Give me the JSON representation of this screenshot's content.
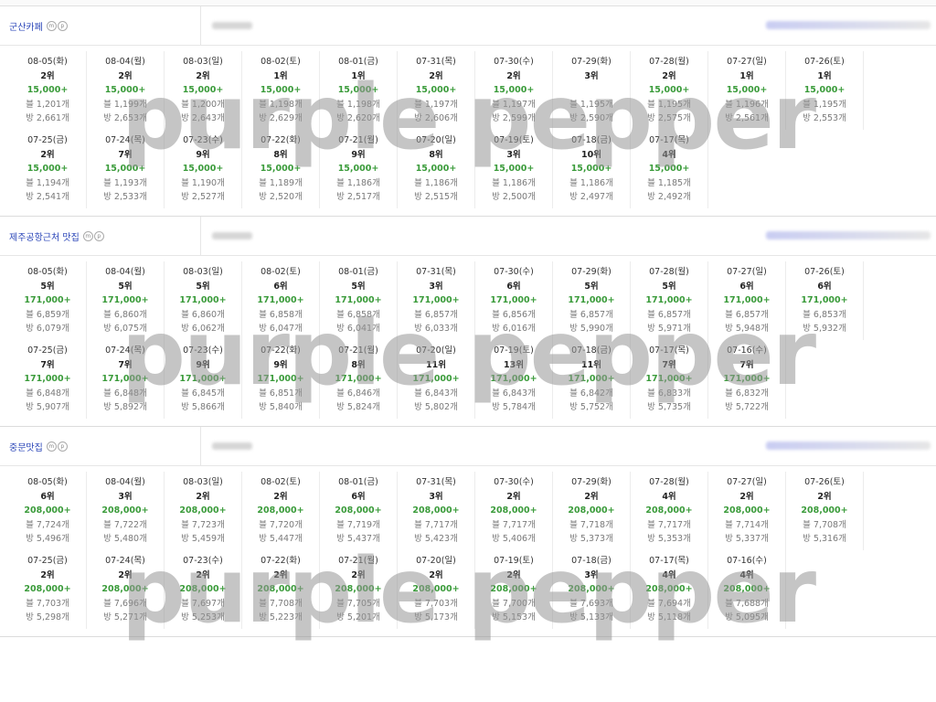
{
  "watermark": "purple pepper",
  "sections": [
    {
      "keyword": "군산카페",
      "icon_labels": [
        "m",
        "p"
      ],
      "rows": [
        [
          {
            "date": "08-05(화)",
            "rank": "2위",
            "vol": "15,000+",
            "blog": "블 1,201개",
            "cafe": "방 2,661개"
          },
          {
            "date": "08-04(월)",
            "rank": "2위",
            "vol": "15,000+",
            "blog": "블 1,199개",
            "cafe": "방 2,653개"
          },
          {
            "date": "08-03(일)",
            "rank": "2위",
            "vol": "15,000+",
            "blog": "블 1,200개",
            "cafe": "방 2,643개"
          },
          {
            "date": "08-02(토)",
            "rank": "1위",
            "vol": "15,000+",
            "blog": "블 1,198개",
            "cafe": "방 2,629개"
          },
          {
            "date": "08-01(금)",
            "rank": "1위",
            "vol": "15,000+",
            "blog": "블 1,198개",
            "cafe": "방 2,620개"
          },
          {
            "date": "07-31(목)",
            "rank": "2위",
            "vol": "15,000+",
            "blog": "블 1,197개",
            "cafe": "방 2,606개"
          },
          {
            "date": "07-30(수)",
            "rank": "2위",
            "vol": "15,000+",
            "blog": "블 1,197개",
            "cafe": "방 2,599개"
          },
          {
            "date": "07-29(화)",
            "rank": "3위",
            "vol": "",
            "blog": "블 1,195개",
            "cafe": "방 2,590개"
          },
          {
            "date": "07-28(월)",
            "rank": "2위",
            "vol": "15,000+",
            "blog": "블 1,195개",
            "cafe": "방 2,575개"
          },
          {
            "date": "07-27(일)",
            "rank": "1위",
            "vol": "15,000+",
            "blog": "블 1,196개",
            "cafe": "방 2,561개"
          },
          {
            "date": "07-26(토)",
            "rank": "1위",
            "vol": "15,000+",
            "blog": "블 1,195개",
            "cafe": "방 2,553개"
          }
        ],
        [
          {
            "date": "07-25(금)",
            "rank": "2위",
            "vol": "15,000+",
            "blog": "블 1,194개",
            "cafe": "방 2,541개"
          },
          {
            "date": "07-24(목)",
            "rank": "7위",
            "vol": "15,000+",
            "blog": "블 1,193개",
            "cafe": "방 2,533개"
          },
          {
            "date": "07-23(수)",
            "rank": "9위",
            "vol": "15,000+",
            "blog": "블 1,190개",
            "cafe": "방 2,527개"
          },
          {
            "date": "07-22(화)",
            "rank": "8위",
            "vol": "15,000+",
            "blog": "블 1,189개",
            "cafe": "방 2,520개"
          },
          {
            "date": "07-21(월)",
            "rank": "9위",
            "vol": "15,000+",
            "blog": "블 1,186개",
            "cafe": "방 2,517개"
          },
          {
            "date": "07-20(일)",
            "rank": "8위",
            "vol": "15,000+",
            "blog": "블 1,186개",
            "cafe": "방 2,515개"
          },
          {
            "date": "07-19(토)",
            "rank": "3위",
            "vol": "15,000+",
            "blog": "블 1,186개",
            "cafe": "방 2,500개"
          },
          {
            "date": "07-18(금)",
            "rank": "10위",
            "vol": "15,000+",
            "blog": "블 1,186개",
            "cafe": "방 2,497개"
          },
          {
            "date": "07-17(목)",
            "rank": "4위",
            "vol": "15,000+",
            "blog": "블 1,185개",
            "cafe": "방 2,492개"
          }
        ]
      ]
    },
    {
      "keyword": "제주공항근처 맛집",
      "icon_labels": [
        "m",
        "p"
      ],
      "rows": [
        [
          {
            "date": "08-05(화)",
            "rank": "5위",
            "vol": "171,000+",
            "blog": "블 6,859개",
            "cafe": "방 6,079개"
          },
          {
            "date": "08-04(월)",
            "rank": "5위",
            "vol": "171,000+",
            "blog": "블 6,860개",
            "cafe": "방 6,075개"
          },
          {
            "date": "08-03(일)",
            "rank": "5위",
            "vol": "171,000+",
            "blog": "블 6,860개",
            "cafe": "방 6,062개"
          },
          {
            "date": "08-02(토)",
            "rank": "6위",
            "vol": "171,000+",
            "blog": "블 6,858개",
            "cafe": "방 6,047개"
          },
          {
            "date": "08-01(금)",
            "rank": "5위",
            "vol": "171,000+",
            "blog": "블 6,858개",
            "cafe": "방 6,041개"
          },
          {
            "date": "07-31(목)",
            "rank": "3위",
            "vol": "171,000+",
            "blog": "블 6,857개",
            "cafe": "방 6,033개"
          },
          {
            "date": "07-30(수)",
            "rank": "6위",
            "vol": "171,000+",
            "blog": "블 6,856개",
            "cafe": "방 6,016개"
          },
          {
            "date": "07-29(화)",
            "rank": "5위",
            "vol": "171,000+",
            "blog": "블 6,857개",
            "cafe": "방 5,990개"
          },
          {
            "date": "07-28(월)",
            "rank": "5위",
            "vol": "171,000+",
            "blog": "블 6,857개",
            "cafe": "방 5,971개"
          },
          {
            "date": "07-27(일)",
            "rank": "6위",
            "vol": "171,000+",
            "blog": "블 6,857개",
            "cafe": "방 5,948개"
          },
          {
            "date": "07-26(토)",
            "rank": "6위",
            "vol": "171,000+",
            "blog": "블 6,853개",
            "cafe": "방 5,932개"
          }
        ],
        [
          {
            "date": "07-25(금)",
            "rank": "7위",
            "vol": "171,000+",
            "blog": "블 6,848개",
            "cafe": "방 5,907개"
          },
          {
            "date": "07-24(목)",
            "rank": "7위",
            "vol": "171,000+",
            "blog": "블 6,848개",
            "cafe": "방 5,892개"
          },
          {
            "date": "07-23(수)",
            "rank": "9위",
            "vol": "171,000+",
            "blog": "블 6,845개",
            "cafe": "방 5,866개"
          },
          {
            "date": "07-22(화)",
            "rank": "9위",
            "vol": "171,000+",
            "blog": "블 6,851개",
            "cafe": "방 5,840개"
          },
          {
            "date": "07-21(월)",
            "rank": "8위",
            "vol": "171,000+",
            "blog": "블 6,846개",
            "cafe": "방 5,824개"
          },
          {
            "date": "07-20(일)",
            "rank": "11위",
            "vol": "171,000+",
            "blog": "블 6,843개",
            "cafe": "방 5,802개"
          },
          {
            "date": "07-19(토)",
            "rank": "13위",
            "vol": "171,000+",
            "blog": "블 6,843개",
            "cafe": "방 5,784개"
          },
          {
            "date": "07-18(금)",
            "rank": "11위",
            "vol": "171,000+",
            "blog": "블 6,842개",
            "cafe": "방 5,752개"
          },
          {
            "date": "07-17(목)",
            "rank": "7위",
            "vol": "171,000+",
            "blog": "블 6,833개",
            "cafe": "방 5,735개"
          },
          {
            "date": "07-16(수)",
            "rank": "7위",
            "vol": "171,000+",
            "blog": "블 6,832개",
            "cafe": "방 5,722개"
          }
        ]
      ]
    },
    {
      "keyword": "중문맛집",
      "icon_labels": [
        "m",
        "p"
      ],
      "rows": [
        [
          {
            "date": "08-05(화)",
            "rank": "6위",
            "vol": "208,000+",
            "blog": "블 7,724개",
            "cafe": "방 5,496개"
          },
          {
            "date": "08-04(월)",
            "rank": "3위",
            "vol": "208,000+",
            "blog": "블 7,722개",
            "cafe": "방 5,480개"
          },
          {
            "date": "08-03(일)",
            "rank": "2위",
            "vol": "208,000+",
            "blog": "블 7,723개",
            "cafe": "방 5,459개"
          },
          {
            "date": "08-02(토)",
            "rank": "2위",
            "vol": "208,000+",
            "blog": "블 7,720개",
            "cafe": "방 5,447개"
          },
          {
            "date": "08-01(금)",
            "rank": "6위",
            "vol": "208,000+",
            "blog": "블 7,719개",
            "cafe": "방 5,437개"
          },
          {
            "date": "07-31(목)",
            "rank": "3위",
            "vol": "208,000+",
            "blog": "블 7,717개",
            "cafe": "방 5,423개"
          },
          {
            "date": "07-30(수)",
            "rank": "2위",
            "vol": "208,000+",
            "blog": "블 7,717개",
            "cafe": "방 5,406개"
          },
          {
            "date": "07-29(화)",
            "rank": "2위",
            "vol": "208,000+",
            "blog": "블 7,718개",
            "cafe": "방 5,373개"
          },
          {
            "date": "07-28(월)",
            "rank": "4위",
            "vol": "208,000+",
            "blog": "블 7,717개",
            "cafe": "방 5,353개"
          },
          {
            "date": "07-27(일)",
            "rank": "2위",
            "vol": "208,000+",
            "blog": "블 7,714개",
            "cafe": "방 5,337개"
          },
          {
            "date": "07-26(토)",
            "rank": "2위",
            "vol": "208,000+",
            "blog": "블 7,708개",
            "cafe": "방 5,316개"
          }
        ],
        [
          {
            "date": "07-25(금)",
            "rank": "2위",
            "vol": "208,000+",
            "blog": "블 7,703개",
            "cafe": "방 5,298개"
          },
          {
            "date": "07-24(목)",
            "rank": "2위",
            "vol": "208,000+",
            "blog": "블 7,696개",
            "cafe": "방 5,271개"
          },
          {
            "date": "07-23(수)",
            "rank": "2위",
            "vol": "208,000+",
            "blog": "블 7,697개",
            "cafe": "방 5,253개"
          },
          {
            "date": "07-22(화)",
            "rank": "2위",
            "vol": "208,000+",
            "blog": "블 7,708개",
            "cafe": "방 5,223개"
          },
          {
            "date": "07-21(월)",
            "rank": "2위",
            "vol": "208,000+",
            "blog": "블 7,705개",
            "cafe": "방 5,201개"
          },
          {
            "date": "07-20(일)",
            "rank": "2위",
            "vol": "208,000+",
            "blog": "블 7,703개",
            "cafe": "방 5,173개"
          },
          {
            "date": "07-19(토)",
            "rank": "2위",
            "vol": "208,000+",
            "blog": "블 7,700개",
            "cafe": "방 5,153개"
          },
          {
            "date": "07-18(금)",
            "rank": "3위",
            "vol": "208,000+",
            "blog": "블 7,693개",
            "cafe": "방 5,133개"
          },
          {
            "date": "07-17(목)",
            "rank": "4위",
            "vol": "208,000+",
            "blog": "블 7,694개",
            "cafe": "방 5,118개"
          },
          {
            "date": "07-16(수)",
            "rank": "4위",
            "vol": "208,000+",
            "blog": "블 7,688개",
            "cafe": "방 5,095개"
          }
        ]
      ]
    }
  ]
}
